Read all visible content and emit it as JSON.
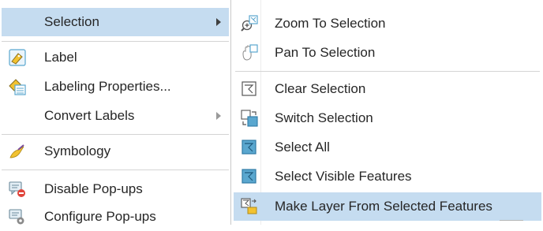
{
  "left_menu": {
    "items": [
      {
        "label": "Selection",
        "icon": "",
        "submenu": true
      },
      {
        "label": "Label",
        "icon": "label-icon",
        "submenu": false
      },
      {
        "label": "Labeling Properties...",
        "icon": "labeling-properties-icon",
        "submenu": false
      },
      {
        "label": "Convert Labels",
        "icon": "",
        "submenu": true
      },
      {
        "label": "Symbology",
        "icon": "symbology-icon",
        "submenu": false
      },
      {
        "label": "Disable Pop-ups",
        "icon": "disable-popups-icon",
        "submenu": false
      },
      {
        "label": "Configure Pop-ups",
        "icon": "configure-popups-icon",
        "submenu": false
      }
    ]
  },
  "right_menu": {
    "items": [
      {
        "label": "Zoom To Selection",
        "icon": "zoom-to-selection-icon"
      },
      {
        "label": "Pan To Selection",
        "icon": "pan-to-selection-icon"
      },
      {
        "label": "Clear Selection",
        "icon": "clear-selection-icon"
      },
      {
        "label": "Switch Selection",
        "icon": "switch-selection-icon"
      },
      {
        "label": "Select All",
        "icon": "select-all-icon"
      },
      {
        "label": "Select Visible Features",
        "icon": "select-visible-features-icon"
      },
      {
        "label": "Make Layer From Selected Features",
        "icon": "make-layer-from-selected-features-icon"
      }
    ]
  },
  "colors": {
    "highlight": "#c5dcf0",
    "icon_blue": "#5aa7cf",
    "accent_yellow": "#f2c230",
    "stop_red": "#e0443b"
  }
}
